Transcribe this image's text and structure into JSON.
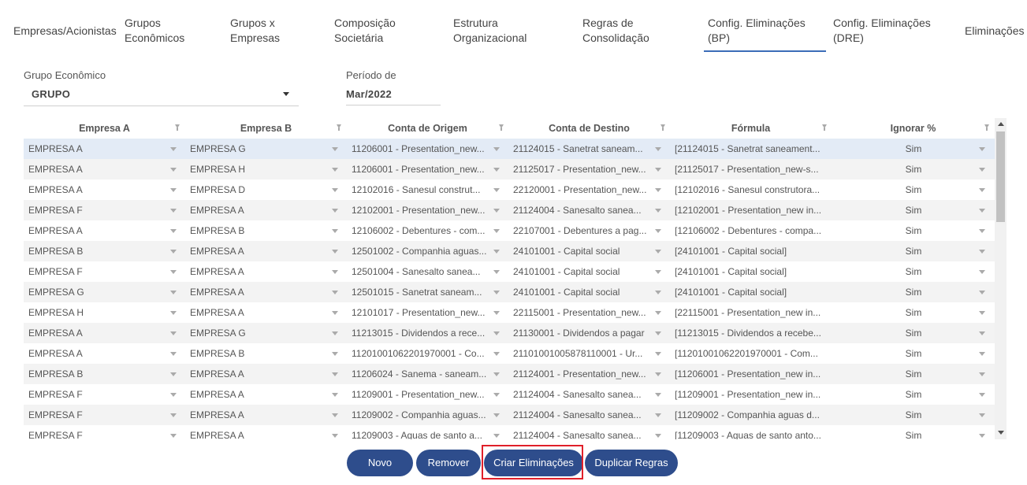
{
  "tabs": [
    {
      "label": "Empresas/Acionistas"
    },
    {
      "label": "Grupos Econômicos"
    },
    {
      "label": "Grupos x Empresas"
    },
    {
      "label": "Composição Societária"
    },
    {
      "label": "Estrutura Organizacional"
    },
    {
      "label": "Regras de Consolidação"
    },
    {
      "label": "Config. Eliminações (BP)"
    },
    {
      "label": "Config. Eliminações (DRE)"
    },
    {
      "label": "Eliminações"
    }
  ],
  "active_tab": "Config. Eliminações (BP)",
  "filters": {
    "grupo_label": "Grupo Econômico",
    "grupo_value": "GRUPO",
    "periodo_label": "Período de",
    "periodo_value": "Mar/2022"
  },
  "grid": {
    "columns": [
      "Empresa A",
      "Empresa B",
      "Conta de Origem",
      "Conta de Destino",
      "Fórmula",
      "Ignorar %"
    ],
    "rows": [
      [
        "EMPRESA A",
        "EMPRESA G",
        "11206001 - Presentation_new...",
        "21124015 - Sanetrat saneam...",
        "[21124015 - Sanetrat saneament...",
        "Sim"
      ],
      [
        "EMPRESA A",
        "EMPRESA H",
        "11206001 - Presentation_new...",
        "21125017 - Presentation_new...",
        "[21125017 - Presentation_new-s...",
        "Sim"
      ],
      [
        "EMPRESA A",
        "EMPRESA D",
        "12102016 - Sanesul construt...",
        "22120001 - Presentation_new...",
        "[12102016 - Sanesul construtora...",
        "Sim"
      ],
      [
        "EMPRESA F",
        "EMPRESA A",
        "12102001 - Presentation_new...",
        "21124004 - Sanesalto sanea...",
        "[12102001 - Presentation_new in...",
        "Sim"
      ],
      [
        "EMPRESA A",
        "EMPRESA B",
        "12106002 - Debentures - com...",
        "22107001 - Debentures a pag...",
        "[12106002 - Debentures - compa...",
        "Sim"
      ],
      [
        "EMPRESA B",
        "EMPRESA A",
        "12501002 - Companhia aguas...",
        "24101001 - Capital social",
        "[24101001 - Capital social]",
        "Sim"
      ],
      [
        "EMPRESA F",
        "EMPRESA A",
        "12501004 - Sanesalto sanea...",
        "24101001 - Capital social",
        "[24101001 - Capital social]",
        "Sim"
      ],
      [
        "EMPRESA G",
        "EMPRESA A",
        "12501015 - Sanetrat saneam...",
        "24101001 - Capital social",
        "[24101001 - Capital social]",
        "Sim"
      ],
      [
        "EMPRESA H",
        "EMPRESA A",
        "12101017 - Presentation_new...",
        "22115001 - Presentation_new...",
        "[22115001 - Presentation_new in...",
        "Sim"
      ],
      [
        "EMPRESA A",
        "EMPRESA G",
        "11213015 - Dividendos a rece...",
        "21130001 - Dividendos a pagar",
        "[11213015 - Dividendos a recebe...",
        "Sim"
      ],
      [
        "EMPRESA A",
        "EMPRESA B",
        "11201001062201970001 - Co...",
        "21101001005878110001 - Ur...",
        "[11201001062201970001 - Com...",
        "Sim"
      ],
      [
        "EMPRESA B",
        "EMPRESA A",
        "11206024 - Sanema - saneam...",
        "21124001 - Presentation_new...",
        "[11206001 - Presentation_new in...",
        "Sim"
      ],
      [
        "EMPRESA F",
        "EMPRESA A",
        "11209001 - Presentation_new...",
        "21124004 - Sanesalto sanea...",
        "[11209001 - Presentation_new in...",
        "Sim"
      ],
      [
        "EMPRESA F",
        "EMPRESA A",
        "11209002 - Companhia aguas...",
        "21124004 - Sanesalto sanea...",
        "[11209002 - Companhia aguas d...",
        "Sim"
      ],
      [
        "EMPRESA F",
        "EMPRESA A",
        "11209003 - Aguas de santo a...",
        "21124004 - Sanesalto sanea...",
        "[11209003 - Aguas de santo anto...",
        "Sim"
      ]
    ]
  },
  "buttons": {
    "novo": "Novo",
    "remover": "Remover",
    "criar": "Criar Eliminações",
    "duplicar": "Duplicar Regras"
  },
  "colors": {
    "button_bg": "#2e4d8c",
    "active_tab_underline": "#3b6cb8",
    "selected_row": "#e3ebf6",
    "highlight": "#e0202a"
  },
  "icons": [
    "filter-icon",
    "dropdown-arrow-icon",
    "scroll-up-icon",
    "scroll-down-icon"
  ]
}
